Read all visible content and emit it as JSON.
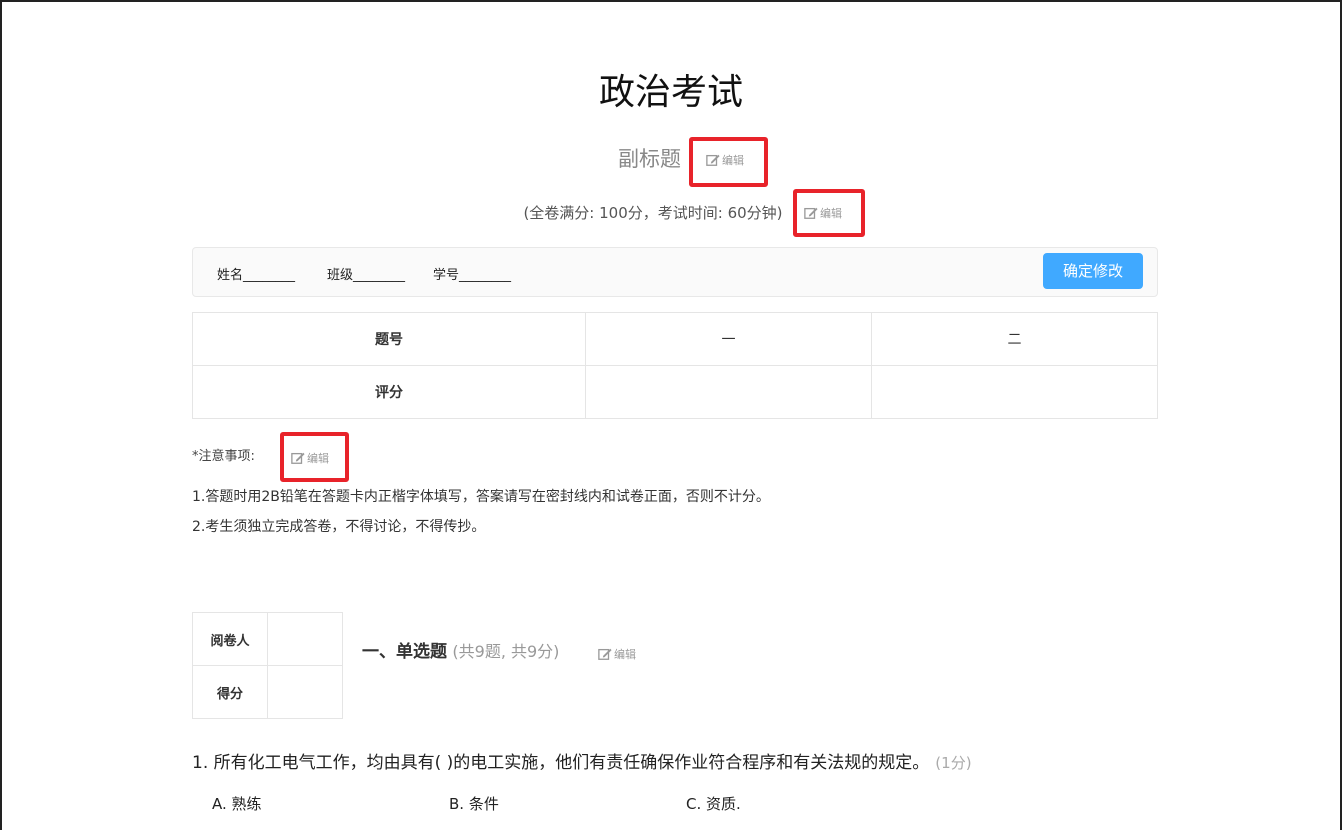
{
  "exam": {
    "title": "政治考试",
    "subtitle": "副标题",
    "info": "(全卷满分: 100分，考试时间: 60分钟)",
    "edit_label": "编辑"
  },
  "student_fields": {
    "name": "姓名________",
    "class": "班级________",
    "id": "学号________",
    "confirm_button": "确定修改"
  },
  "score_table": {
    "row_headers": [
      "题号",
      "评分"
    ],
    "columns": [
      "一",
      "二"
    ]
  },
  "notice": {
    "label": "*注意事项:",
    "items": [
      "1.答题时用2B铅笔在答题卡内正楷字体填写，答案请写在密封线内和试卷正面，否则不计分。",
      "2.考生须独立完成答卷，不得讨论，不得传抄。"
    ]
  },
  "reviewer_table": {
    "reviewer": "阅卷人",
    "score": "得分"
  },
  "section": {
    "title": "一、单选题",
    "count": "(共9题, 共9分)"
  },
  "question": {
    "text": "1. 所有化工电气工作，均由具有(  )的电工实施，他们有责任确保作业符合程序和有关法规的规定。",
    "points": "(1分)",
    "options": [
      "A. 熟练",
      "B. 条件",
      "C. 资质."
    ]
  }
}
